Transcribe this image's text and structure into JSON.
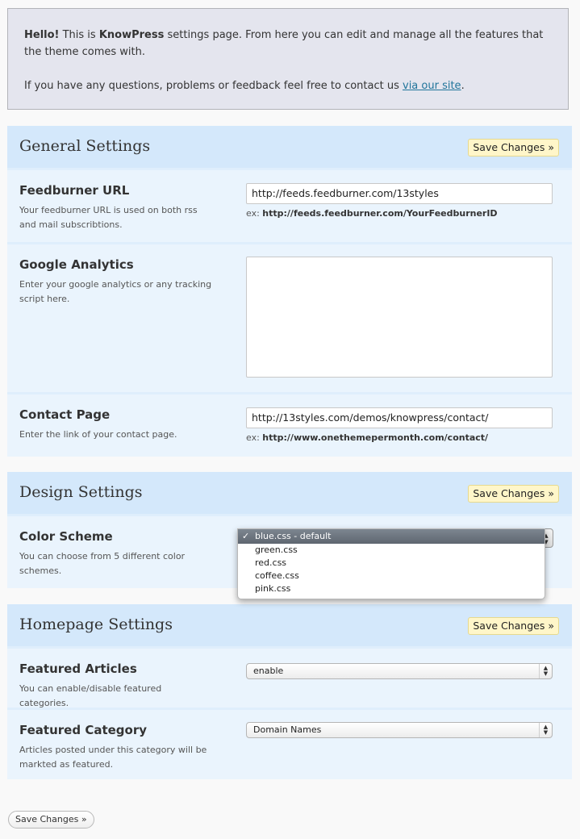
{
  "notice": {
    "hello": "Hello!",
    "text1": " This is ",
    "brand": "KnowPress",
    "text2": " settings page. From here you can edit and manage all the features that the theme comes with.",
    "line2": "If you have any questions, problems or feedback feel free to contact us ",
    "link": "via our site",
    "end": "."
  },
  "sections": {
    "general": {
      "title": "General Settings",
      "save_label": "Save Changes »",
      "feedburner": {
        "label": "Feedburner URL",
        "desc": "Your feedburner URL is used on both rss and mail subscribtions.",
        "value": "http://feeds.feedburner.com/13styles",
        "hint_prefix": "ex: ",
        "hint_example": "http://feeds.feedburner.com/YourFeedburnerID"
      },
      "analytics": {
        "label": "Google Analytics",
        "desc": "Enter your google analytics or any tracking script here.",
        "value": ""
      },
      "contact": {
        "label": "Contact Page",
        "desc": "Enter the link of your contact page.",
        "value": "http://13styles.com/demos/knowpress/contact/",
        "hint_prefix": "ex: ",
        "hint_example": "http://www.onethemepermonth.com/contact/"
      }
    },
    "design": {
      "title": "Design Settings",
      "save_label": "Save Changes »",
      "color_scheme": {
        "label": "Color Scheme",
        "desc": "You can choose from 5 different color schemes.",
        "check": "✓",
        "options": [
          "blue.css - default",
          "green.css",
          "red.css",
          "coffee.css",
          "pink.css"
        ]
      }
    },
    "homepage": {
      "title": "Homepage Settings",
      "save_label": "Save Changes »",
      "featured_articles": {
        "label": "Featured Articles",
        "desc": "You can enable/disable featured categories.",
        "value": "enable"
      },
      "featured_category": {
        "label": "Featured Category",
        "desc": "Articles posted under this category will be markted as featured.",
        "value": "Domain Names"
      }
    }
  },
  "footer": {
    "save_label": "Save Changes »"
  },
  "colors": {
    "section_header": "#d4e8fb",
    "row_bg": "#eaf4fd",
    "save_button": "#fff6c9",
    "notice_bg": "#e4e5ee",
    "link": "#21759b"
  },
  "icons": {
    "select_arrows": "updown-arrows-icon",
    "checkmark": "checkmark-icon",
    "resize": "resize-grip-icon"
  }
}
